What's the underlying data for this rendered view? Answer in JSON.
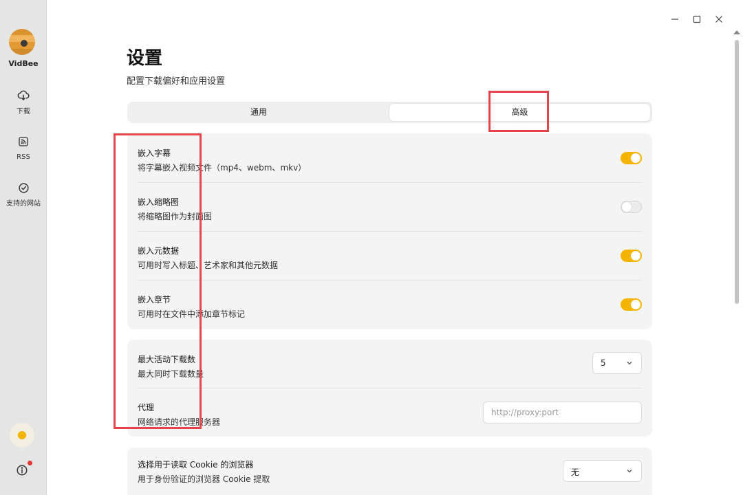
{
  "sidebar": {
    "app_name": "VidBee",
    "items": [
      {
        "label": "下载",
        "icon": "download-icon"
      },
      {
        "label": "RSS",
        "icon": "rss-icon"
      },
      {
        "label": "支持的网站",
        "icon": "check-circle-icon"
      }
    ],
    "bottom_icons": [
      "sun-icon",
      "info-icon"
    ]
  },
  "window_controls": [
    "minimize-icon",
    "maximize-icon",
    "close-icon"
  ],
  "header": {
    "title": "设置",
    "subtitle": "配置下载偏好和应用设置"
  },
  "tabs": [
    {
      "label": "通用",
      "active": false
    },
    {
      "label": "高级",
      "active": true
    }
  ],
  "embed_settings": [
    {
      "label": "嵌入字幕",
      "desc": "将字幕嵌入视频文件（mp4、webm、mkv）",
      "enabled": true
    },
    {
      "label": "嵌入缩略图",
      "desc": "将缩略图作为封面图",
      "enabled": false
    },
    {
      "label": "嵌入元数据",
      "desc": "可用时写入标题、艺术家和其他元数据",
      "enabled": true
    },
    {
      "label": "嵌入章节",
      "desc": "可用时在文件中添加章节标记",
      "enabled": true
    }
  ],
  "download_settings": {
    "max_downloads": {
      "label": "最大活动下载数",
      "desc": "最大同时下载数量",
      "value": "5"
    },
    "proxy": {
      "label": "代理",
      "desc": "网络请求的代理服务器",
      "value": "",
      "placeholder": "http://proxy:port"
    }
  },
  "cookie_settings": {
    "label": "选择用于读取 Cookie 的浏览器",
    "desc": "用于身份验证的浏览器 Cookie 提取",
    "value": "无"
  },
  "colors": {
    "accent": "#f5b400",
    "highlight_box": "#e5444d",
    "sidebar_bg": "#e5e5e5",
    "card_bg": "#f4f4f4"
  }
}
